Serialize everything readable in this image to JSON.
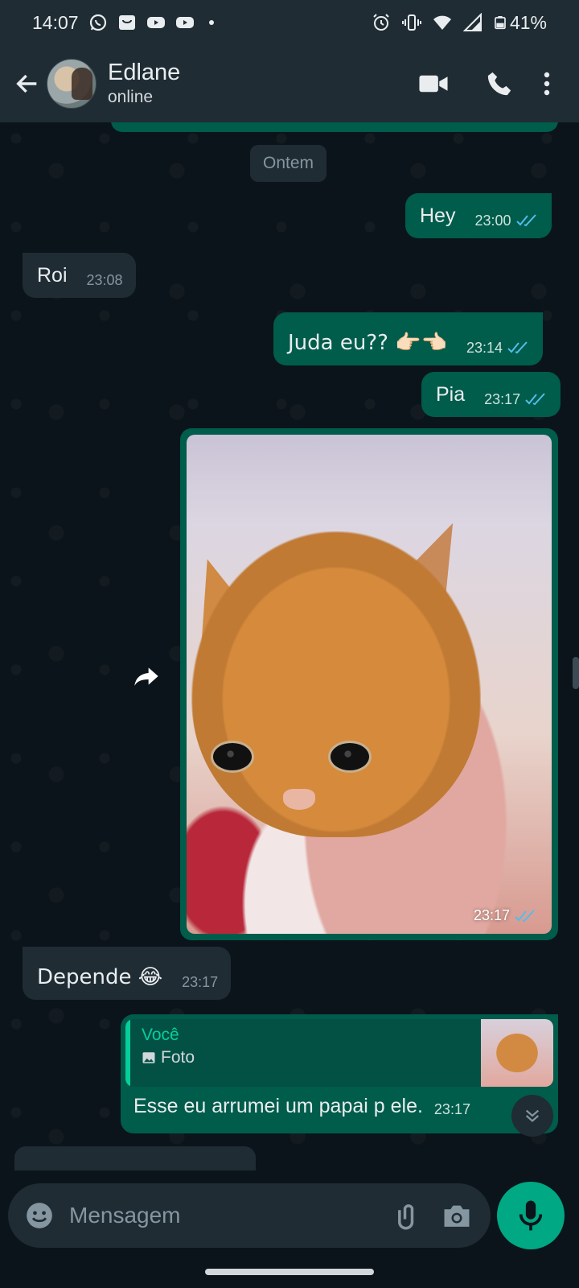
{
  "status_bar": {
    "time": "14:07",
    "battery": "41%",
    "left_icons": [
      "whatsapp-icon",
      "notification-icon",
      "youtube-icon",
      "youtube-icon"
    ],
    "right_icons": [
      "alarm-icon",
      "vibrate-icon",
      "wifi-icon",
      "signal-icon",
      "battery-icon"
    ]
  },
  "header": {
    "contact_name": "Edlane",
    "contact_status": "online"
  },
  "chat": {
    "date_separator": "Ontem",
    "messages": [
      {
        "direction": "out",
        "text": "Hey",
        "time": "23:00",
        "read": true
      },
      {
        "direction": "in",
        "text": "Roi",
        "time": "23:08"
      },
      {
        "direction": "out",
        "text": "Juda eu?? 👉🏻👈🏻",
        "time": "23:14",
        "read": true
      },
      {
        "direction": "out",
        "text": "Pia",
        "time": "23:17",
        "read": true
      },
      {
        "direction": "out",
        "type": "photo",
        "time": "23:17",
        "read": true
      },
      {
        "direction": "in",
        "text": "Depende 😂",
        "time": "23:17"
      },
      {
        "direction": "out",
        "text": "Esse eu arrumei um papai p ele.",
        "time": "23:17",
        "quote": {
          "author": "Você",
          "body": "Foto"
        }
      }
    ]
  },
  "composer": {
    "placeholder": "Mensagem"
  },
  "colors": {
    "outgoing_bubble": "#005c4b",
    "incoming_bubble": "#1f2c34",
    "accent": "#00a884",
    "read_ticks": "#53bdeb"
  }
}
